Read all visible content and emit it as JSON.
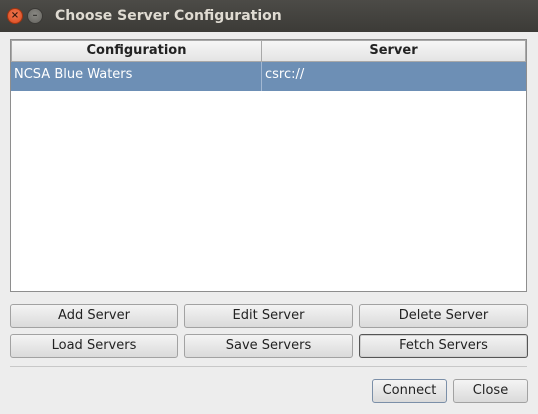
{
  "window": {
    "title": "Choose Server Configuration",
    "close_glyph": "×",
    "minimize_glyph": "–"
  },
  "table": {
    "columns": [
      "Configuration",
      "Server"
    ],
    "rows": [
      {
        "configuration": "NCSA Blue Waters",
        "server": "csrc://",
        "selected": true
      }
    ]
  },
  "buttons": {
    "add_server": "Add Server",
    "edit_server": "Edit Server",
    "delete_server": "Delete Server",
    "load_servers": "Load Servers",
    "save_servers": "Save Servers",
    "fetch_servers": "Fetch Servers",
    "connect": "Connect",
    "close": "Close"
  },
  "colors": {
    "selection": "#6d8fb5",
    "titlebar": "#3c3b37",
    "close_button": "#e2562b"
  }
}
